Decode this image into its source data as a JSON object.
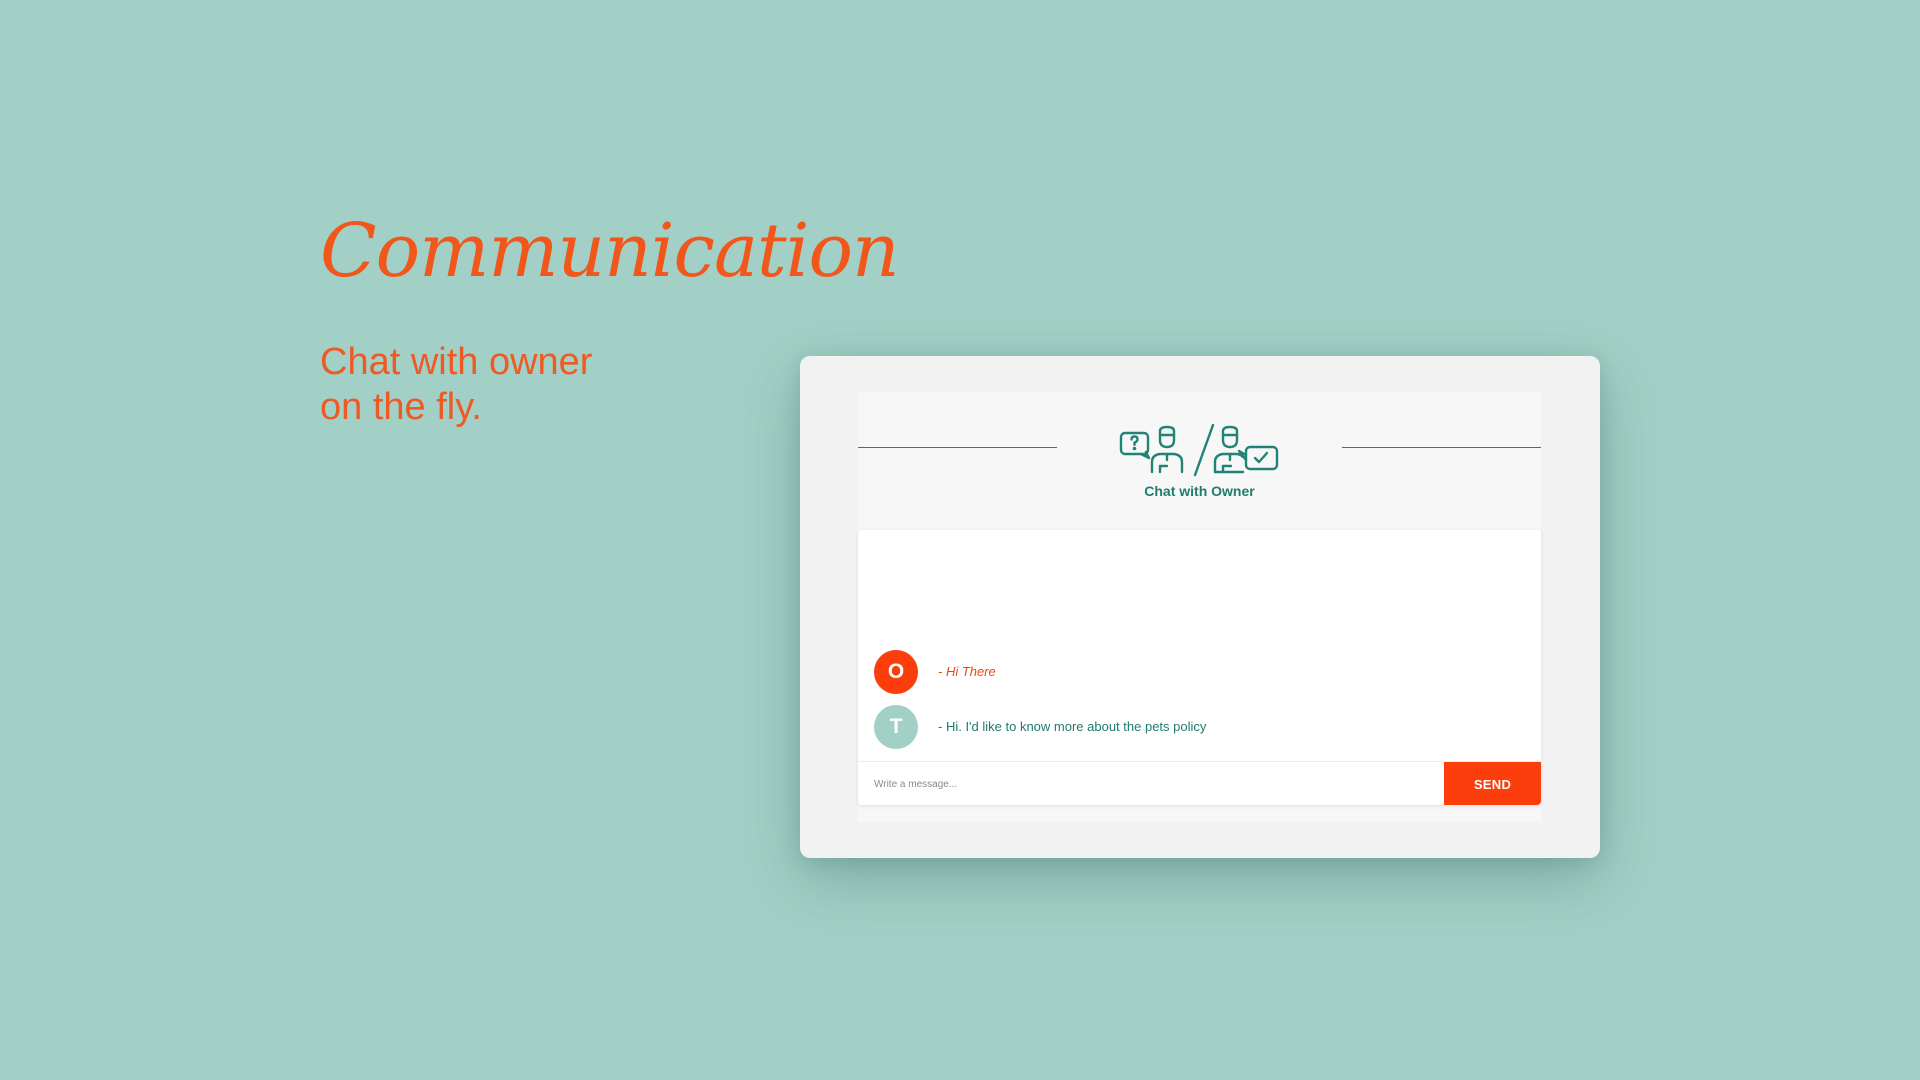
{
  "hero": {
    "title": "Communication",
    "subtitle_line1": "Chat with owner",
    "subtitle_line2": "on the fly."
  },
  "chat": {
    "header_title": "Chat with Owner",
    "header_icon": "chat-question-answer-people-icon",
    "messages": [
      {
        "sender_initial": "O",
        "text": "- Hi There"
      },
      {
        "sender_initial": "T",
        "text": "- Hi. I'd like to know more about the pets policy"
      }
    ],
    "input_placeholder": "Write a message...",
    "send_label": "SEND"
  },
  "colors": {
    "background": "#a2d0c6",
    "accent_orange": "#fc3d0c",
    "teal": "#1f7c6e",
    "card": "#f2f2f2"
  }
}
